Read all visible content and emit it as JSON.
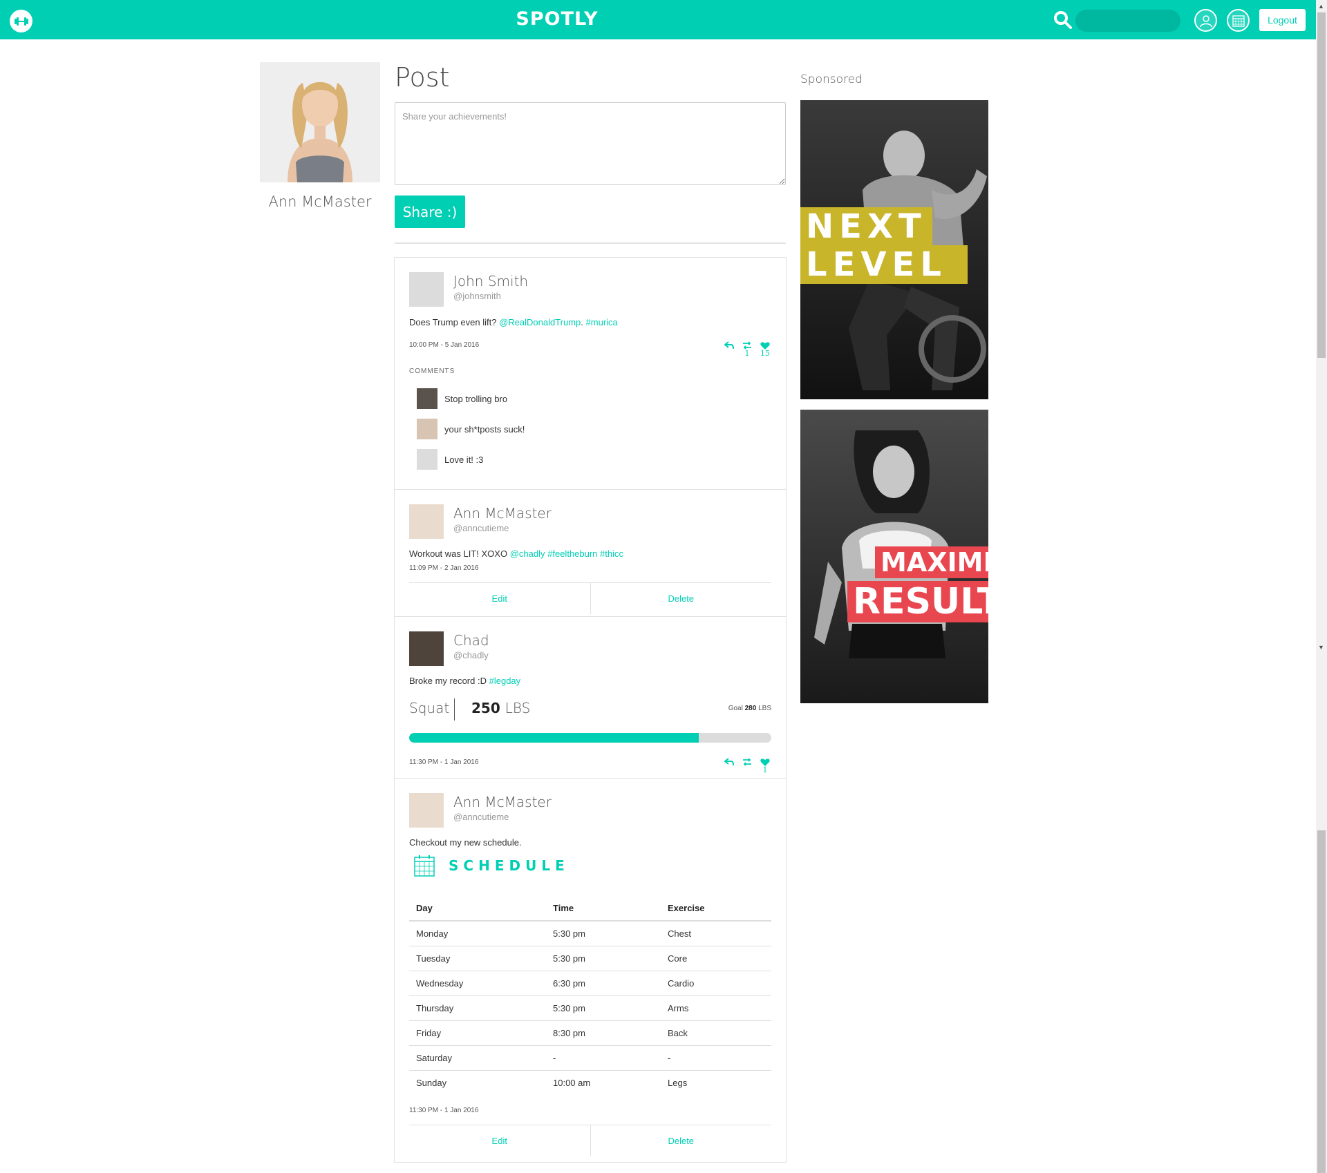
{
  "header": {
    "brand": "SPOTLY",
    "search_placeholder": "",
    "logout_label": "Logout",
    "accent_color": "#00cfb4"
  },
  "profile": {
    "name": "Ann McMaster"
  },
  "composer": {
    "heading": "Post",
    "placeholder": "Share your achievements!",
    "share_label": "Share :)"
  },
  "feed": {
    "post1": {
      "name": "John Smith",
      "handle": "@johnsmith",
      "text": "Does Trump even lift?",
      "mention": "@RealDonaldTrump",
      "hashtag": "#murica",
      "time": "10:00 PM - 5 Jan 2016",
      "retweets": "1",
      "likes": "15",
      "comments_label": "COMMENTS",
      "comments": [
        {
          "text": "Stop trolling bro"
        },
        {
          "text": "your sh*tposts suck!"
        },
        {
          "text": "Love it! :3"
        }
      ]
    },
    "post2": {
      "name": "Ann McMaster",
      "handle": "@anncutieme",
      "text": "Workout was LIT! XOXO",
      "mention": "@chadly",
      "hashtag1": "#feeltheburn",
      "hashtag2": "#thicc",
      "time": "11:09 PM - 2 Jan 2016",
      "edit_label": "Edit",
      "delete_label": "Delete"
    },
    "post3": {
      "name": "Chad",
      "handle": "@chadly",
      "text": "Broke my record :D",
      "hashtag": "#legday",
      "lift": "Squat",
      "lift_value": "250",
      "lift_unit": "LBS",
      "goal_label": "Goal",
      "goal_value": "280",
      "goal_unit": "LBS",
      "progress": 0.8,
      "time": "11:30 PM - 1 Jan 2016",
      "likes": "1"
    },
    "post4": {
      "name": "Ann McMaster",
      "handle": "@anncutieme",
      "text": "Checkout my new schedule.",
      "schedule_title": "SCHEDULE",
      "columns": {
        "day": "Day",
        "time": "Time",
        "exercise": "Exercise"
      },
      "rows": [
        {
          "day": "Monday",
          "time": "5:30 pm",
          "exercise": "Chest"
        },
        {
          "day": "Tuesday",
          "time": "5:30 pm",
          "exercise": "Core"
        },
        {
          "day": "Wednesday",
          "time": "6:30 pm",
          "exercise": "Cardio"
        },
        {
          "day": "Thursday",
          "time": "5:30 pm",
          "exercise": "Arms"
        },
        {
          "day": "Friday",
          "time": "8:30 pm",
          "exercise": "Back"
        },
        {
          "day": "Saturday",
          "time": "-",
          "exercise": "-"
        },
        {
          "day": "Sunday",
          "time": "10:00 am",
          "exercise": "Legs"
        }
      ],
      "time": "11:30 PM - 1 Jan 2016",
      "edit_label": "Edit",
      "delete_label": "Delete"
    }
  },
  "sponsored": {
    "label": "Sponsored",
    "ad1": {
      "line1": "NEXT",
      "line2": "LEVEL",
      "color": "#c9b52a"
    },
    "ad2": {
      "line1": "MAXIMIZE",
      "line2": "RESULTS",
      "color": "#e8474f"
    }
  }
}
